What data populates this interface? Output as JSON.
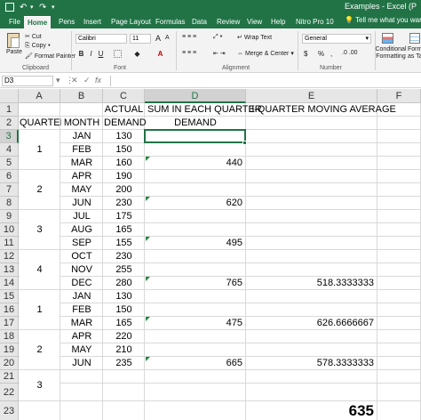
{
  "app": {
    "title": "Examples - Excel (P",
    "tabs": [
      "File",
      "Home",
      "Pens",
      "Insert",
      "Page Layout",
      "Formulas",
      "Data",
      "Review",
      "View",
      "Help",
      "Nitro Pro 10"
    ],
    "active_tab": "Home",
    "tell_me": "Tell me what you want"
  },
  "ribbon": {
    "clipboard": {
      "paste": "Paste",
      "cut": "Cut",
      "copy": "Copy",
      "format_painter": "Format Painter",
      "label": "Clipboard"
    },
    "font": {
      "name": "Calibri",
      "size": "11",
      "label": "Font",
      "bold": "B",
      "italic": "I",
      "underline": "U",
      "grow": "A",
      "shrink": "A"
    },
    "alignment": {
      "wrap_text": "Wrap Text",
      "merge_center": "Merge & Center",
      "label": "Alignment"
    },
    "number": {
      "format": "General",
      "currency": "$",
      "percent": "%",
      "comma": ",",
      "label": "Number"
    },
    "styles": {
      "conditional_formatting": "Conditional Formatting",
      "format_as_table": "Format as Table"
    }
  },
  "formula_bar": {
    "name_box": "D3",
    "cancel": "✕",
    "enter": "✓",
    "fx": "fx",
    "formula": ""
  },
  "sheet": {
    "columns": [
      "A",
      "B",
      "C",
      "D",
      "E",
      "F"
    ],
    "selected_column": "D",
    "rows": [
      "1",
      "2",
      "3",
      "4",
      "5",
      "6",
      "7",
      "8",
      "9",
      "10",
      "11",
      "12",
      "13",
      "14",
      "15",
      "16",
      "17",
      "18",
      "19",
      "20",
      "21",
      "22",
      "23"
    ],
    "selected_row": "3",
    "headers": {
      "c1": "ACTUAL",
      "d1": "SUM IN EACH QUARTER",
      "e1": "3-QUARTER MOVING AVERAGE",
      "a2": "QUARTER",
      "b2": "MONTH",
      "c2": "DEMAND",
      "d2": "DEMAND"
    },
    "months": [
      "JAN",
      "FEB",
      "MAR",
      "APR",
      "MAY",
      "JUN",
      "JUL",
      "AUG",
      "SEP",
      "OCT",
      "NOV",
      "DEC",
      "JAN",
      "FEB",
      "MAR",
      "APR",
      "MAY",
      "JUN"
    ],
    "demand": [
      "130",
      "150",
      "160",
      "190",
      "200",
      "230",
      "175",
      "165",
      "155",
      "230",
      "255",
      "280",
      "130",
      "150",
      "165",
      "220",
      "210",
      "235"
    ],
    "quarters": [
      "1",
      "2",
      "3",
      "4",
      "1",
      "2",
      "3"
    ],
    "quarter_sums": {
      "r5": "440",
      "r8": "620",
      "r11": "495",
      "r14": "765",
      "r17": "475",
      "r20": "665"
    },
    "moving_avg": {
      "r14": "518.3333333",
      "r17": "626.6666667",
      "r20": "578.3333333"
    },
    "result": "635"
  }
}
